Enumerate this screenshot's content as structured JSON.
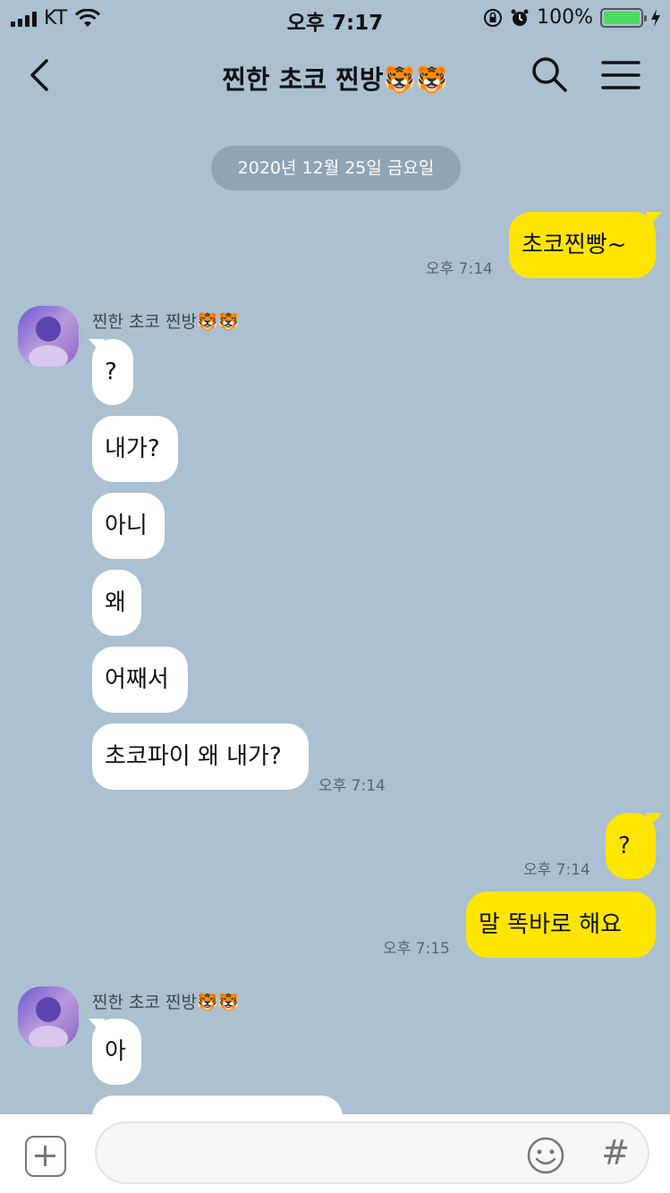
{
  "status_bar": {
    "carrier": "KT",
    "time": "오후 7:17",
    "battery_text": "100%",
    "battery_level": 1.0
  },
  "header": {
    "title": "찐한 초코 찐방🐯🐯"
  },
  "date_divider": "2020년 12월 25일 금요일",
  "colors": {
    "background": "#abc0d1",
    "my_bubble": "#fee500",
    "other_bubble": "#ffffff",
    "battery": "#4cd964"
  },
  "messages": [
    {
      "text": "초코찐빵~",
      "time": "오후 7:14"
    },
    {
      "sender": "찐한 초코 찐방🐯🐯"
    },
    {
      "text": "?"
    },
    {
      "text": "내가?"
    },
    {
      "text": "아니"
    },
    {
      "text": "왜"
    },
    {
      "text": "어째서"
    },
    {
      "text": "초코파이 왜 내가?",
      "time": "오후 7:14"
    },
    {
      "text": "?",
      "time": "오후 7:14"
    },
    {
      "text": "말 똑바로 해요",
      "time": "오후 7:15"
    },
    {
      "sender": "찐한 초코 찐방🐯🐯"
    },
    {
      "text": "아"
    }
  ],
  "icons": {
    "back": "chevron-left-icon",
    "search": "search-icon",
    "menu": "hamburger-menu-icon",
    "plus": "plus-square-icon",
    "emoji": "smiley-icon",
    "hash": "hash-icon",
    "avatar": "profile-avatar"
  },
  "input": {
    "placeholder": ""
  },
  "hash_symbol": "#"
}
